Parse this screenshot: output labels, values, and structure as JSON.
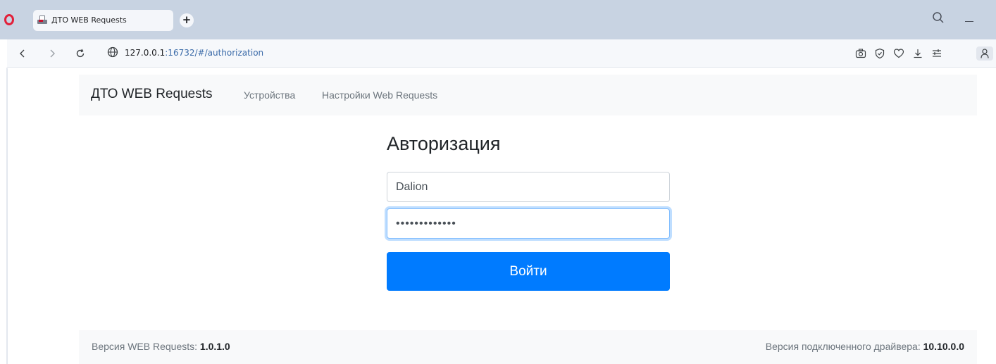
{
  "browser": {
    "tab_title": "ДТО WEB Requests",
    "new_tab_label": "+",
    "url_host": "127.0.0.1",
    "url_rest": ":16732/#/authorization",
    "icons": {
      "browser_logo": "opera-logo-icon",
      "tab_favicon": "printer-icon",
      "search": "search-icon",
      "minimize": "minimize-icon",
      "back": "chevron-left-icon",
      "forward": "chevron-right-icon",
      "reload": "reload-icon",
      "site_info": "globe-icon",
      "toolbar": [
        "camera-icon",
        "shield-check-icon",
        "heart-icon",
        "download-icon",
        "easy-setup-icon",
        "profile-icon"
      ]
    }
  },
  "navbar": {
    "brand": "ДТО WEB Requests",
    "links": [
      "Устройства",
      "Настройки Web Requests"
    ]
  },
  "login": {
    "title": "Авторизация",
    "username_value": "Dalion",
    "password_value": "•••••••••••••",
    "submit_label": "Войти"
  },
  "footer": {
    "left_label": "Версия WEB Requests:",
    "left_value": "1.0.1.0",
    "right_label": "Версия подключенного драйвера:",
    "right_value": "10.10.0.0"
  },
  "colors": {
    "primary": "#007bff",
    "navbar_bg": "#f8f9fa",
    "tabstrip_bg": "#c8d3e2",
    "opera_red": "#e2203a"
  }
}
